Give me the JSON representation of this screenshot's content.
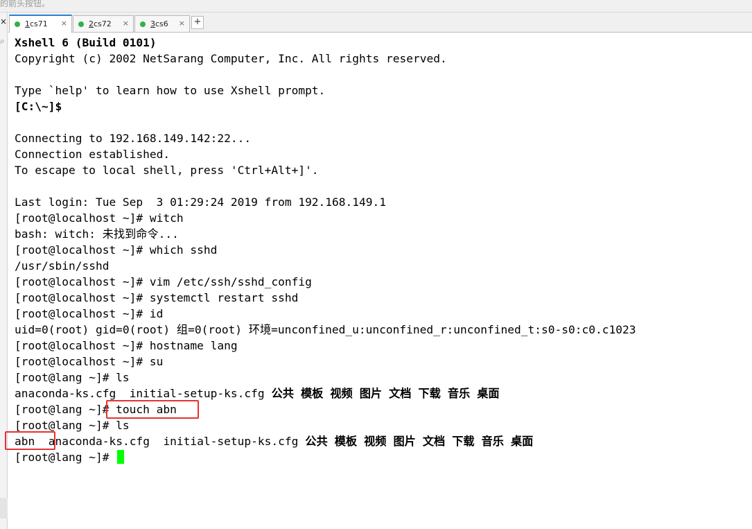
{
  "hint_text": "的箭头按钮。",
  "tabs": [
    {
      "num": "1",
      "name": "cs71",
      "active": true,
      "dot_color": "#2fb24a"
    },
    {
      "num": "2",
      "name": "cs72",
      "active": false,
      "dot_color": "#2fb24a"
    },
    {
      "num": "3",
      "name": "cs6",
      "active": false,
      "dot_color": "#2fb24a"
    }
  ],
  "tab_close_glyph": "×",
  "tab_add_glyph": "+",
  "terminal": {
    "lines": [
      "Xshell 6 (Build 0101)",
      "Copyright (c) 2002 NetSarang Computer, Inc. All rights reserved.",
      "",
      "Type `help' to learn how to use Xshell prompt.",
      "[C:\\~]$",
      "",
      "Connecting to 192.168.149.142:22...",
      "Connection established.",
      "To escape to local shell, press 'Ctrl+Alt+]'.",
      "",
      "Last login: Tue Sep  3 01:29:24 2019 from 192.168.149.1",
      "[root@localhost ~]# witch",
      "bash: witch: 未找到命令...",
      "[root@localhost ~]# which sshd",
      "/usr/sbin/sshd",
      "[root@localhost ~]# vim /etc/ssh/sshd_config",
      "[root@localhost ~]# systemctl restart sshd",
      "[root@localhost ~]# id",
      "uid=0(root) gid=0(root) 组=0(root) 环境=unconfined_u:unconfined_r:unconfined_t:s0-s0:c0.c1023",
      "[root@localhost ~]# hostname lang",
      "[root@localhost ~]# su",
      "[root@lang ~]# ls",
      "",
      "[root@lang ~]# touch abn",
      "[root@lang ~]# ls",
      "",
      "[root@lang ~]# "
    ],
    "ls1": {
      "files": [
        "anaconda-ks.cfg",
        "initial-setup-ks.cfg"
      ],
      "dirs": [
        "公共",
        "模板",
        "视频",
        "图片",
        "文档",
        "下载",
        "音乐",
        "桌面"
      ]
    },
    "ls2": {
      "files": [
        "abn",
        "anaconda-ks.cfg",
        "initial-setup-ks.cfg"
      ],
      "dirs": [
        "公共",
        "模板",
        "视频",
        "图片",
        "文档",
        "下载",
        "音乐",
        "桌面"
      ]
    }
  },
  "colors": {
    "cursor": "#00ff00",
    "annotation": "#e83030",
    "tab_dot": "#2fb24a",
    "active_tab_accent": "#2a7fd4"
  },
  "icons": {
    "left_close": "close-icon",
    "left_search": "search-icon",
    "tab_add": "plus-icon",
    "tab_close": "close-icon",
    "tab_status": "dot-icon"
  }
}
